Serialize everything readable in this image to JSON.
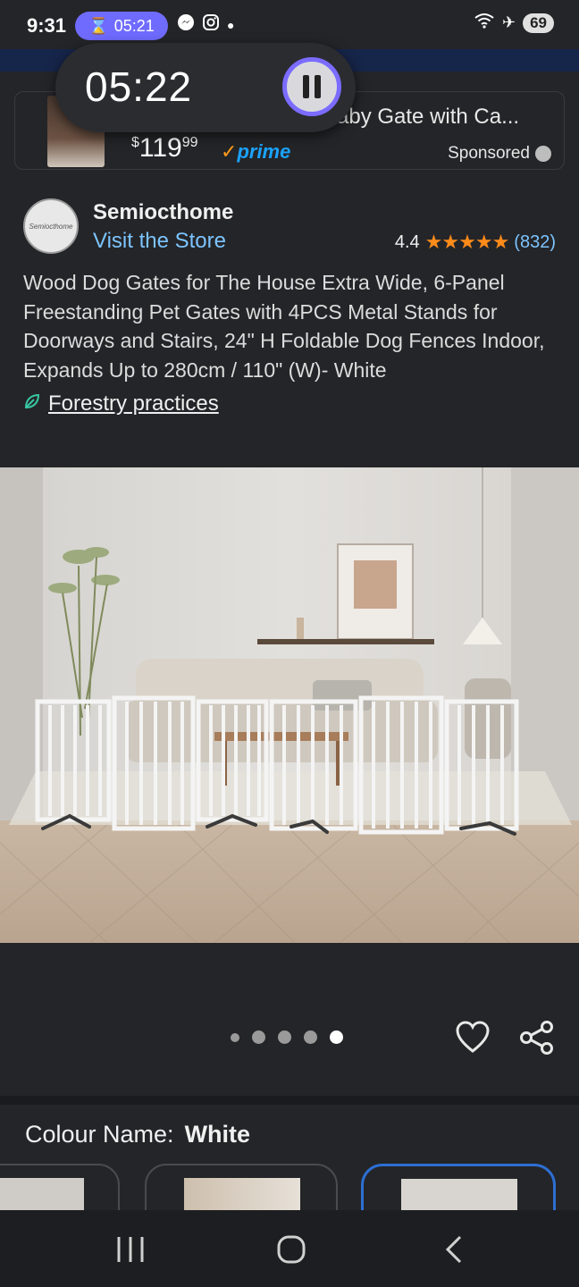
{
  "status_bar": {
    "time": "9:31",
    "timer": "05:21",
    "battery": "69"
  },
  "float_timer": {
    "time": "05:22"
  },
  "sponsored": {
    "title": "aby Gate with Ca...",
    "price_whole": "119",
    "price_fraction": "99",
    "currency": "$",
    "prime": "prime",
    "label": "Sponsored"
  },
  "brand": {
    "logo_text": "Semiocthome",
    "name": "Semiocthome",
    "store_link": "Visit the Store",
    "rating": "4.4",
    "rating_stars": 4.4,
    "rating_count": "(832)"
  },
  "product": {
    "title": "Wood Dog Gates for The House Extra Wide, 6-Panel Freestanding Pet Gates with 4PCS Metal Stands for Doorways and Stairs, 24\" H Foldable Dog Fences Indoor, Expands Up to 280cm / 110\" (W)- White",
    "forestry_link": "Forestry practices"
  },
  "carousel": {
    "dot_count": 5,
    "active_index": 4
  },
  "colour": {
    "label": "Colour Name:",
    "value": "White"
  },
  "colors": {
    "accent_link": "#7cc4ff",
    "star": "#ff8b1a",
    "selected_border": "#2d6fd3",
    "timer_pill": "#6f6bff"
  }
}
